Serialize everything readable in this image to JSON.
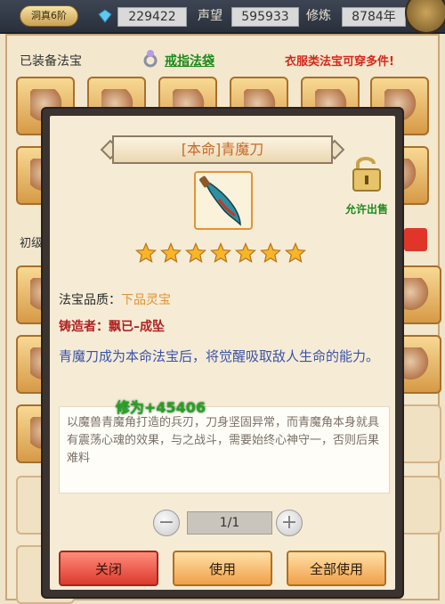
{
  "topbar": {
    "realm": "洞真6阶",
    "gem_value": "229422",
    "prestige_label": "声望",
    "prestige_value": "595933",
    "cultivation_label": "修炼",
    "cultivation_value": "8784年"
  },
  "background": {
    "equipped_title": "已装备法宝",
    "ring_bag_link": "戒指法袋",
    "clothing_note": "衣服类法宝可穿多件!",
    "section_label": "初级"
  },
  "dialog": {
    "title": "[本命]青魔刀",
    "allow_sale": "允许出售",
    "stars": 7,
    "quality_label": "法宝品质：",
    "quality_value": "下品灵宝",
    "smith_label": "铸造者：",
    "smith_value": "飘已–成坠",
    "effect_text": "青魔刀成为本命法宝后，将觉醒吸取敌人生命的能力。",
    "cultivation_gain": "修为+45406",
    "description": "以魔兽青魔角打造的兵刃，刀身坚固异常，而青魔角本身就具有震荡心魂的效果，与之战斗，需要始终心神守一，否则后果难料",
    "page_indicator": "1/1",
    "minus_icon": "minus-icon",
    "plus_icon": "plus-icon",
    "buttons": {
      "close": "关闭",
      "use": "使用",
      "use_all": "全部使用"
    }
  },
  "colors": {
    "title_orange": "#c86a2a",
    "quality_orange": "#e39233",
    "smith_red": "#b02222",
    "effect_blue": "#3a52a8",
    "gain_green": "#24a324",
    "note_red": "#d4281c"
  }
}
